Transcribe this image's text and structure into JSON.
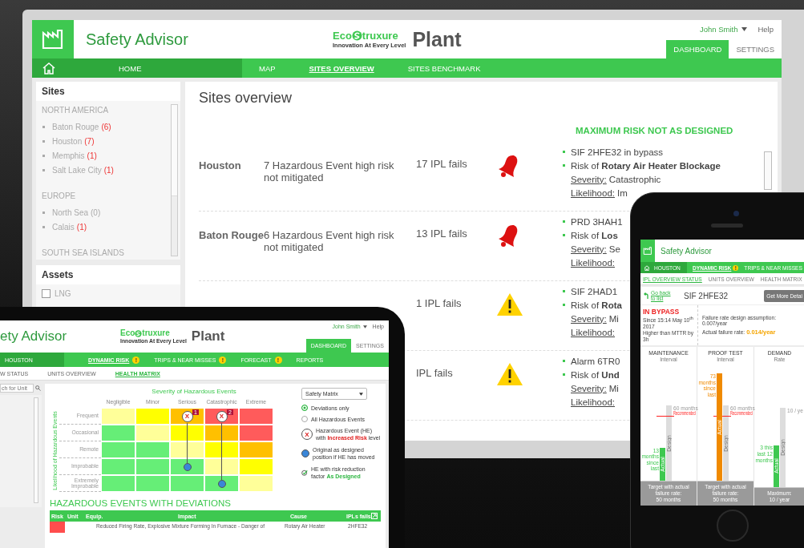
{
  "monitor": {
    "header": {
      "app_title": "Safety Advisor",
      "brand": {
        "prefix": "Eco",
        "suffix": "truxure",
        "tagline": "Innovation At Every Level",
        "product": "Plant"
      },
      "user": "John Smith",
      "help": "Help",
      "tabs": [
        {
          "label": "DASHBOARD",
          "selected": true
        },
        {
          "label": "SETTINGS",
          "selected": false
        }
      ]
    },
    "nav": [
      {
        "kind": "home",
        "label": "HOME",
        "selected": false
      },
      {
        "kind": "link",
        "label": "MAP",
        "selected": false
      },
      {
        "kind": "link",
        "label": "SITES OVERVIEW",
        "selected": true
      },
      {
        "kind": "link",
        "label": "SITES BENCHMARK",
        "selected": false
      }
    ],
    "sites": {
      "title": "Sites",
      "regions": [
        {
          "name": "NORTH AMERICA",
          "items": [
            {
              "name": "Baton Rouge",
              "count": "(6)",
              "alert": true
            },
            {
              "name": "Houston",
              "count": "(7)",
              "alert": true
            },
            {
              "name": "Memphis",
              "count": "(1)",
              "alert": true
            },
            {
              "name": "Salt Lake City",
              "count": "(1)",
              "alert": true
            }
          ]
        },
        {
          "name": "EUROPE",
          "items": [
            {
              "name": "North Sea",
              "count": "(0)",
              "alert": false
            },
            {
              "name": "Calais",
              "count": "(1)",
              "alert": true
            }
          ]
        },
        {
          "name": "SOUTH SEA ISLANDS"
        }
      ]
    },
    "assets": {
      "title": "Assets",
      "items": [
        {
          "label": "LNG",
          "checked": false
        }
      ]
    },
    "overview": {
      "title": "Sites overview",
      "column_heading": "MAXIMUM RISK NOT AS DESIGNED",
      "rows": [
        {
          "site": "Houston",
          "events": "7 Hazardous Event high risk not mitigated",
          "ipl": "17 IPL fails",
          "kind": "alarm",
          "details": [
            "SIF 2HFE32 in bypass",
            "Risk of **Rotary Air Heater Blockage**"
          ],
          "severity": {
            "label": "Severity:",
            "value": "Catastrophic"
          },
          "likelihood": {
            "label": "Likelihood:",
            "value": "Im"
          }
        },
        {
          "site": "Baton Rouge",
          "events": "6 Hazardous Event high risk not mitigated",
          "ipl": "13 IPL fails",
          "kind": "alarm",
          "details": [
            "PRD 3HAH1",
            "Risk of **Los**"
          ],
          "severity": {
            "label": "Severity:",
            "value": "Se"
          },
          "likelihood": {
            "label": "Likelihood:"
          }
        },
        {
          "ipl": "1 IPL fails",
          "kind": "warning",
          "details": [
            "SIF 2HAD1",
            "Risk of **Rota**"
          ],
          "severity": {
            "label": "Severity:",
            "value": "Mi"
          },
          "likelihood": {
            "label": "Likelihood:"
          }
        },
        {
          "ipl": "IPL fails",
          "kind": "warning",
          "details": [
            "Alarm 6TR0",
            "Risk of **Und**"
          ],
          "severity": {
            "label": "Severity:",
            "value": "Mi"
          },
          "likelihood": {
            "label": "Likelihood:"
          }
        }
      ]
    }
  },
  "tablet": {
    "header": {
      "app_title": "ety Advisor",
      "brand": {
        "prefix": "Eco",
        "suffix": "truxure",
        "tagline": "Innovation At Every Level",
        "product": "Plant"
      },
      "user": "John Smith",
      "help": "Help",
      "tabs": [
        {
          "label": "DASHBOARD",
          "selected": true
        },
        {
          "label": "SETTINGS",
          "selected": false
        }
      ]
    },
    "nav": [
      {
        "kind": "home",
        "label": "HOUSTON",
        "selected": false
      },
      {
        "kind": "link",
        "label": "DYNAMIC RISK",
        "selected": true,
        "badge": "!"
      },
      {
        "kind": "link",
        "label": "TRIPS & NEAR MISSES",
        "selected": false,
        "badge": "!"
      },
      {
        "kind": "link",
        "label": "FORECAST",
        "selected": false,
        "badge": "!"
      },
      {
        "kind": "link",
        "label": "REPORTS",
        "selected": false
      }
    ],
    "subnav": [
      {
        "label": "W STATUS",
        "selected": false
      },
      {
        "label": "UNITS OVERVIEW",
        "selected": false
      },
      {
        "label": "HEALTH MATRIX",
        "selected": true
      }
    ],
    "search": {
      "placeholder": "ch for Unit"
    },
    "matrix": {
      "title": "Severity of Hazardous Events",
      "axis_label": "Likelihood of Hazardous Events",
      "columns": [
        "Negligible",
        "Minor",
        "Serious",
        "Catastrophic",
        "Extreme"
      ],
      "rows": [
        {
          "label": "Frequent",
          "cells": [
            {
              "color": "#ffff99"
            },
            {
              "color": "#ffff00"
            },
            {
              "color": "#ffc000",
              "marker": {
                "kind": "hazard",
                "symbol": "X",
                "badge": "1"
              }
            },
            {
              "color": "#ff5b5b",
              "marker": {
                "kind": "hazard",
                "symbol": "X",
                "badge": "2"
              }
            },
            {
              "color": "#ff5b5b"
            }
          ]
        },
        {
          "label": "Occasional",
          "cells": [
            {
              "color": "#66ee77"
            },
            {
              "color": "#ffff99"
            },
            {
              "color": "#ffff00"
            },
            {
              "color": "#ffc000"
            },
            {
              "color": "#ff5b5b"
            }
          ]
        },
        {
          "label": "Remote",
          "cells": [
            {
              "color": "#66ee77"
            },
            {
              "color": "#66ee77"
            },
            {
              "color": "#ffff99"
            },
            {
              "color": "#ffff00"
            },
            {
              "color": "#ffc000"
            }
          ]
        },
        {
          "label": "Improbable",
          "cells": [
            {
              "color": "#66ee77"
            },
            {
              "color": "#66ee77"
            },
            {
              "color": "#66ee77",
              "marker": {
                "kind": "original"
              }
            },
            {
              "color": "#ffff99"
            },
            {
              "color": "#ffff00"
            }
          ]
        },
        {
          "label": "Extremely Improbable",
          "cells": [
            {
              "color": "#66ee77"
            },
            {
              "color": "#66ee77"
            },
            {
              "color": "#66ee77"
            },
            {
              "color": "#66ee77",
              "marker": {
                "kind": "original"
              }
            },
            {
              "color": "#ffff99"
            }
          ]
        }
      ]
    },
    "view_select": {
      "value": "Safety Matrix"
    },
    "filters": [
      {
        "label": "Deviations only",
        "selected": true
      },
      {
        "label": "All Hazardous Events",
        "selected": false
      }
    ],
    "legend": [
      {
        "kind": "hazard",
        "symbol": "X",
        "text": "Hazardous Event (HE) with **Increased Risk** level"
      },
      {
        "kind": "original",
        "text": "Original as designed position if HE has moved"
      },
      {
        "kind": "designed",
        "text": "HE with risk reduction factor **As Designed**"
      }
    ],
    "table": {
      "title": "HAZARDOUS EVENTS WITH DEVIATIONS",
      "columns": [
        "Risk",
        "Unit",
        "Equip.",
        "Impact",
        "Cause",
        "IPLs fails"
      ],
      "rows": [
        {
          "color": "#ff4d4d",
          "impact": "Reduced Firing Rate, Explosive Mixture Forming In Furnace - Danger of",
          "cause": "Rotary Air Heater",
          "ipls": "2HFE32"
        }
      ]
    }
  },
  "phone": {
    "app_title": "Safety Advisor",
    "nav": [
      {
        "kind": "home",
        "label": "HOUSTON",
        "selected": false
      },
      {
        "kind": "link",
        "label": "DYNAMIC RISK",
        "selected": true,
        "badge": "!"
      },
      {
        "kind": "link",
        "label": "TRIPS & NEAR MISSES",
        "selected": false
      }
    ],
    "subnav": [
      {
        "label": "IPL OVERVIEW STATUS",
        "selected": true
      },
      {
        "label": "UNITS OVERVIEW",
        "selected": false
      },
      {
        "label": "HEALTH MATRIX",
        "selected": false
      }
    ],
    "back_link": "Go back to list",
    "item_title": "SIF 2HFE32",
    "detail_button": "Get More Detai",
    "status": {
      "label": "IN BYPASS",
      "since": "Since 15:14 May 10$^{th}$ 2017",
      "note": "Higher than MTTR by 3h"
    },
    "rates": {
      "design": "Failure rate design assumption: 0.007/year",
      "actual_label": "Actual failure rate:",
      "actual_value": "0.014/year"
    },
    "metrics": [
      {
        "title": "MAINTENANCE",
        "subtitle": "Interval",
        "design": {
          "level": 0.68,
          "label": "60 months",
          "bar_label": "Design"
        },
        "recommended": {
          "level": 0.58,
          "label": "Recommended"
        },
        "actual": {
          "level": 0.3,
          "color": "#3ec850",
          "label": "13 months since last",
          "bar_label": "Actual"
        },
        "footer": [
          "Target with actual failure rate:",
          "50 months"
        ]
      },
      {
        "title": "PROOF TEST",
        "subtitle": "Interval",
        "design": {
          "level": 0.68,
          "label": "60 months",
          "bar_label": "Design"
        },
        "recommended": {
          "level": 0.58,
          "label": "Recommended"
        },
        "actual": {
          "level": 0.97,
          "color": "#f08a00",
          "label": "73 months since last",
          "bar_label": "Actual"
        },
        "footer": [
          "Target with actual failure rate:",
          "50 months"
        ]
      },
      {
        "title": "DEMAND",
        "subtitle": "Rate",
        "design": {
          "level": 0.68,
          "label": "10 / ye",
          "bar_label": "Design"
        },
        "actual": {
          "level": 0.36,
          "color": "#3ec850",
          "label": "3 this last 12 months",
          "bar_label": "Actual"
        },
        "footer": [
          "Maximum:",
          "10 / year"
        ]
      }
    ]
  }
}
